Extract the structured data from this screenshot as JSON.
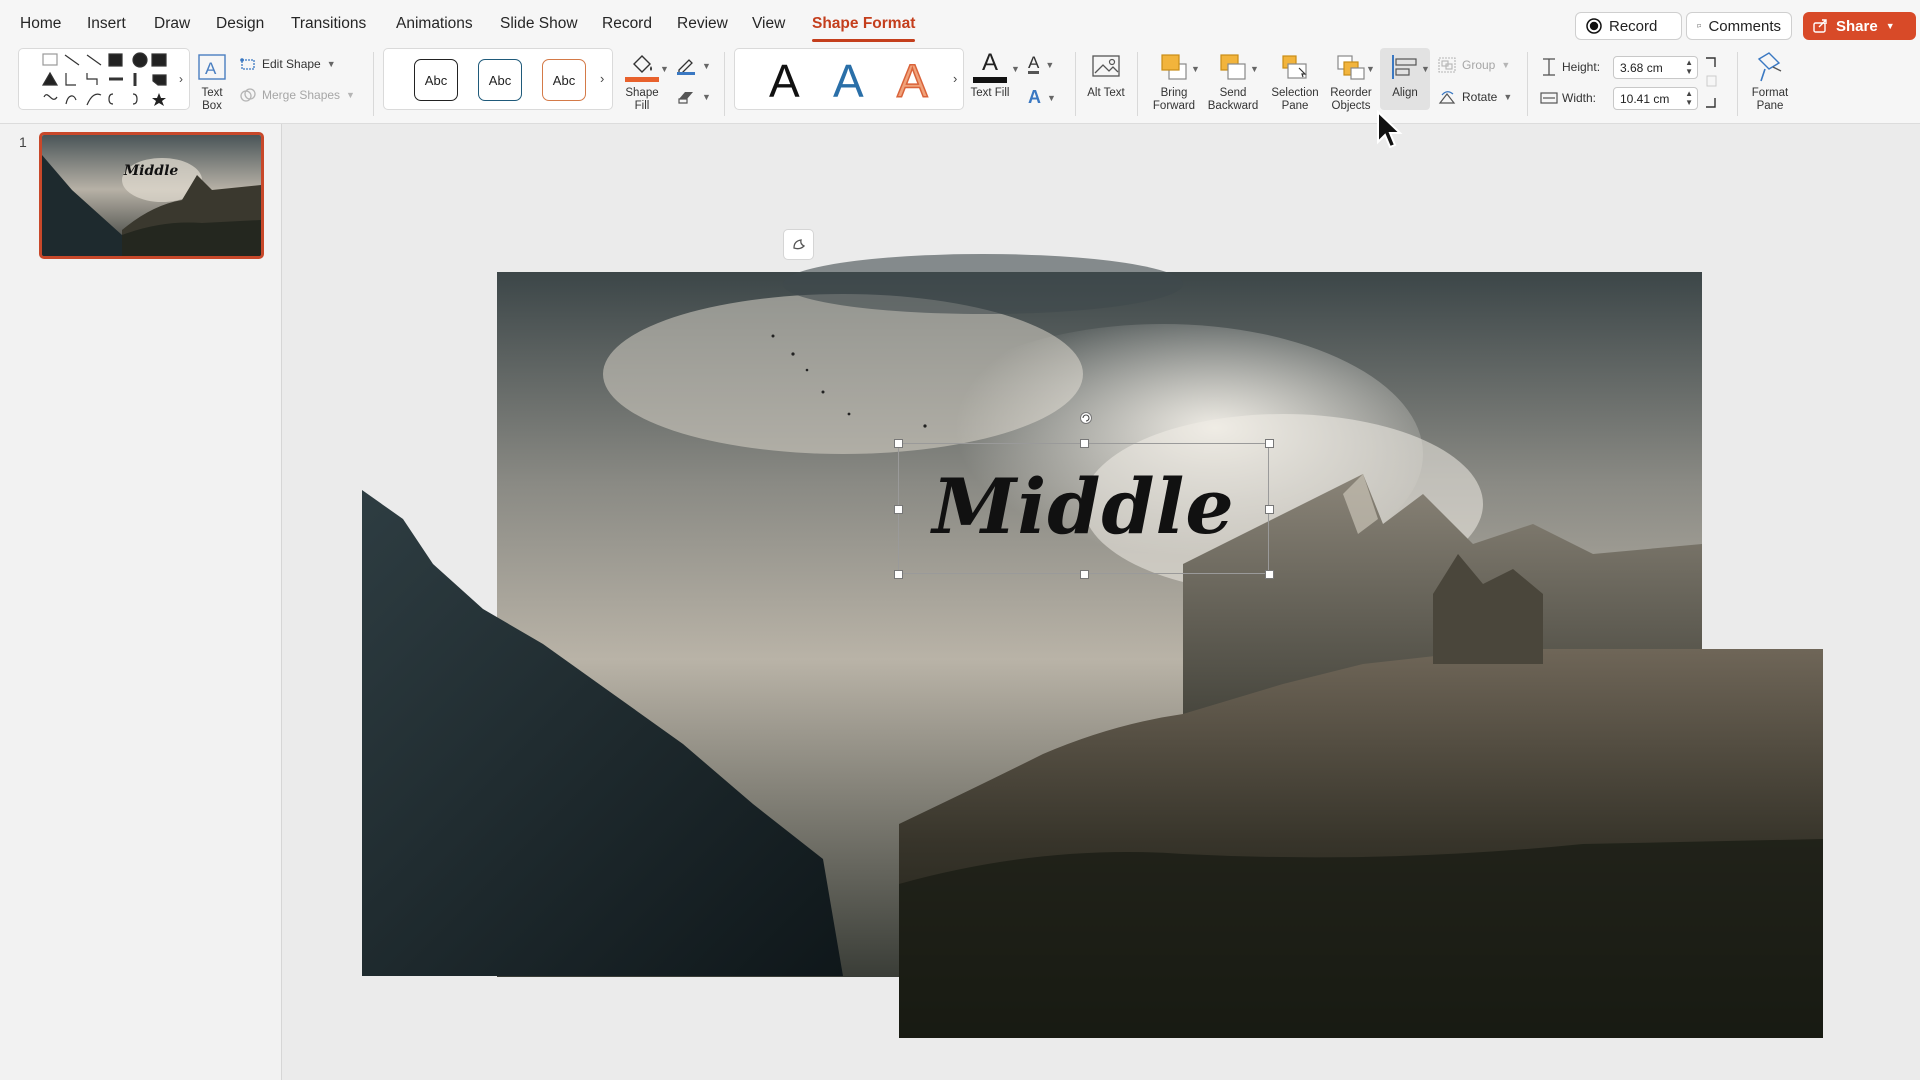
{
  "tabs": [
    {
      "id": "home",
      "label": "Home"
    },
    {
      "id": "insert",
      "label": "Insert"
    },
    {
      "id": "draw",
      "label": "Draw"
    },
    {
      "id": "design",
      "label": "Design"
    },
    {
      "id": "transitions",
      "label": "Transitions"
    },
    {
      "id": "animations",
      "label": "Animations"
    },
    {
      "id": "slideshow",
      "label": "Slide Show"
    },
    {
      "id": "record",
      "label": "Record"
    },
    {
      "id": "review",
      "label": "Review"
    },
    {
      "id": "view",
      "label": "View"
    },
    {
      "id": "shapeformat",
      "label": "Shape Format",
      "active": true
    }
  ],
  "header_buttons": {
    "record": "Record",
    "comments": "Comments",
    "share": "Share"
  },
  "ribbon": {
    "text_box": "Text Box",
    "edit_shape": "Edit Shape",
    "merge_shapes": "Merge Shapes",
    "style_sample": "Abc",
    "shape_fill": "Shape Fill",
    "wordart_letter": "A",
    "text_fill": "Text Fill",
    "alt_text": "Alt Text",
    "bring_forward": "Bring Forward",
    "send_backward": "Send Backward",
    "selection_pane": "Selection Pane",
    "reorder_objects": "Reorder Objects",
    "align": "Align",
    "group": "Group",
    "rotate": "Rotate",
    "height_label": "Height:",
    "height_value": "3.68 cm",
    "width_label": "Width:",
    "width_value": "10.41 cm",
    "format_pane": "Format Pane"
  },
  "thumbnails": [
    {
      "number": "1",
      "text": "Middle"
    }
  ],
  "slide": {
    "title_text": "Middle"
  },
  "colors": {
    "accent": "#c43e1c",
    "share_bg": "#d84a28",
    "shape_fill_bar": "#e8612c"
  }
}
